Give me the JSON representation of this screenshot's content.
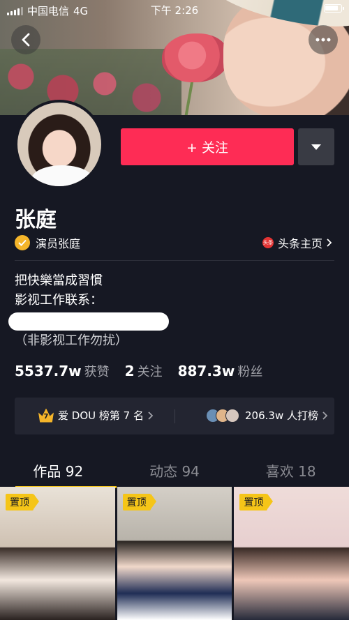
{
  "status_bar": {
    "carrier": "中国电信",
    "network": "4G",
    "time": "下午 2:26"
  },
  "profile": {
    "follow_label": "+ 关注",
    "name": "张庭",
    "verification": "演员张庭",
    "toutiao_label": "头条主页",
    "toutiao_icon_text": "头条",
    "bio_lines": [
      "把快樂當成習慣",
      "影视工作联系：",
      "（非影视工作勿扰）"
    ],
    "stats": [
      {
        "value": "5537.7w",
        "label": "获赞"
      },
      {
        "value": "2",
        "label": "关注"
      },
      {
        "value": "887.3w",
        "label": "粉丝"
      }
    ]
  },
  "rank": {
    "crown_number": "7",
    "left_text": "爱 DOU 榜第 7 名",
    "right_text": "206.3w 人打榜"
  },
  "tabs": [
    {
      "label": "作品 92",
      "active": true
    },
    {
      "label": "动态 94",
      "active": false
    },
    {
      "label": "喜欢 18",
      "active": false
    }
  ],
  "videos": [
    {
      "pin_label": "置顶"
    },
    {
      "pin_label": "置顶"
    },
    {
      "pin_label": "置顶"
    }
  ],
  "icons": [
    "back-icon",
    "more-icon",
    "dropdown-icon",
    "verified-icon",
    "toutiao-icon",
    "crown-icon",
    "chevron-right-icon"
  ],
  "colors": {
    "background": "#161823",
    "follow": "#fe2c55",
    "accent": "#f5c518",
    "verified": "#f5b52a"
  }
}
